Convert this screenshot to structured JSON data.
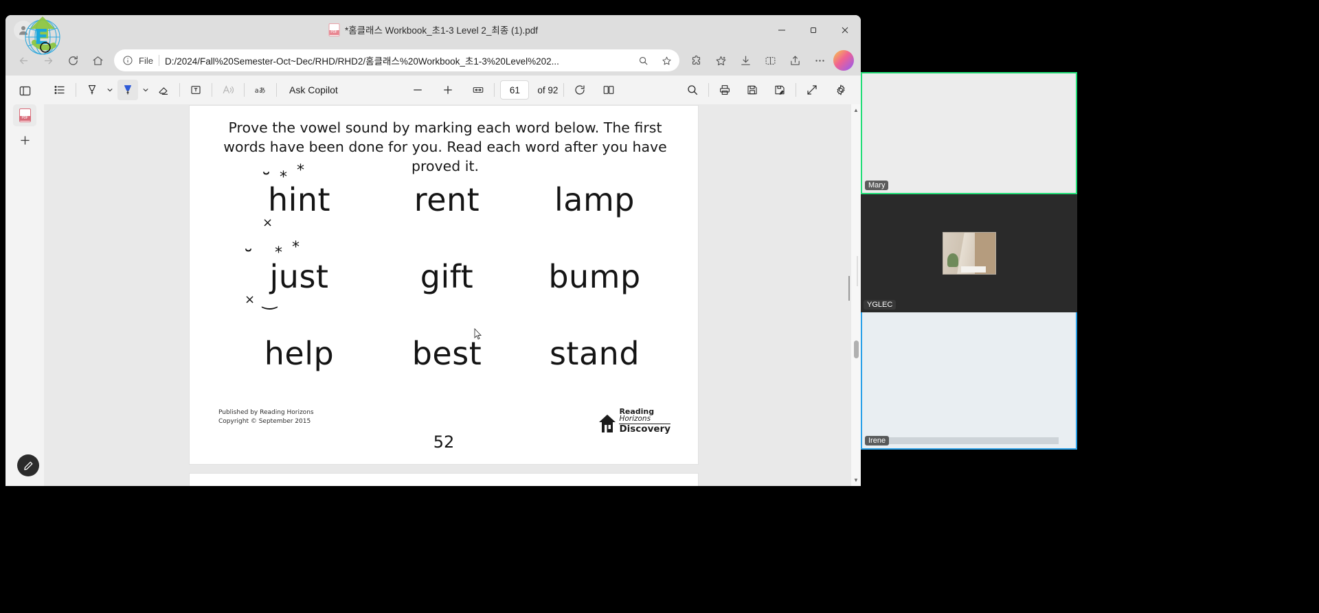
{
  "window": {
    "tab_title": "*홈클래스 Workbook_초1-3 Level 2_최종 (1).pdf",
    "minimize_label": "Minimize",
    "restore_label": "Restore",
    "close_label": "Close"
  },
  "navbar": {
    "back_label": "Back",
    "forward_label": "Forward",
    "refresh_label": "Refresh",
    "home_label": "Home",
    "scheme_label": "File",
    "url": "D:/2024/Fall%20Semester-Oct~Dec/RHD/RHD2/홈클래스%20Workbook_초1-3%20Level%202...",
    "zoom_icon": "search-icon",
    "favorite_icon": "star-icon",
    "extensions_icon": "puzzle-icon",
    "collections_icon": "collections-icon",
    "downloads_icon": "download-icon",
    "split_icon": "split-screen-icon",
    "share_icon": "share-icon",
    "more_icon": "ellipsis-icon",
    "copilot_icon": "copilot-icon"
  },
  "leftrail": {
    "sidebar_toggle": "sidebar-toggle-icon",
    "pdf_item": "pdf-file-icon",
    "add_item": "plus-icon",
    "edit_item": "pencil-icon"
  },
  "pdf_toolbar": {
    "toc_label": "Table of contents",
    "highlight_label": "Highlight",
    "highlight_chevron": "chevron-down-icon",
    "pen_label": "Draw",
    "pen_chevron": "chevron-down-icon",
    "erase_label": "Erase",
    "textbox_label": "Add text",
    "readaloud_label": "Read aloud",
    "translate_label": "Translate",
    "copilot_label": "Ask Copilot",
    "zoom_out_label": "Zoom out",
    "zoom_in_label": "Zoom in",
    "fit_label": "Fit to width",
    "page_current": "61",
    "page_total": "of 92",
    "rotate_label": "Rotate",
    "layout_label": "Page view",
    "search_label": "Search",
    "print_label": "Print",
    "save_label": "Save",
    "save_as_label": "Save as",
    "fullscreen_label": "Full screen",
    "settings_label": "Settings"
  },
  "worksheet": {
    "instructions": "Prove the vowel sound by marking each word below. The first words have been done for you. Read each word after you have proved it.",
    "rows": [
      [
        {
          "word": "hint",
          "marked": true,
          "marks": [
            "breve",
            "star",
            "star",
            "x"
          ]
        },
        {
          "word": "rent",
          "marked": false,
          "marks": []
        },
        {
          "word": "lamp",
          "marked": false,
          "marks": []
        }
      ],
      [
        {
          "word": "just",
          "marked": true,
          "marks": [
            "breve",
            "star",
            "star",
            "x",
            "smile"
          ]
        },
        {
          "word": "gift",
          "marked": false,
          "marks": []
        },
        {
          "word": "bump",
          "marked": false,
          "marks": []
        }
      ],
      [
        {
          "word": "help",
          "marked": false,
          "marks": []
        },
        {
          "word": "best",
          "marked": false,
          "marks": []
        },
        {
          "word": "stand",
          "marked": false,
          "marks": []
        }
      ]
    ],
    "published_by": "Published by Reading Horizons",
    "copyright": "Copyright © September 2015",
    "page_number": "52",
    "logo_line1": "Reading",
    "logo_line2": "Horizons",
    "logo_line3": "Discovery"
  },
  "video_panel": {
    "participants": [
      {
        "name": "Mary",
        "state": "speaking"
      },
      {
        "name": "YGLEC",
        "state": "idle"
      },
      {
        "name": "Irene",
        "state": "active"
      }
    ]
  },
  "colors": {
    "accent_blue": "#2f5bd7",
    "speaking_green": "#22dd77",
    "active_blue": "#2aa0e8",
    "pdf_red": "#d86a78"
  }
}
